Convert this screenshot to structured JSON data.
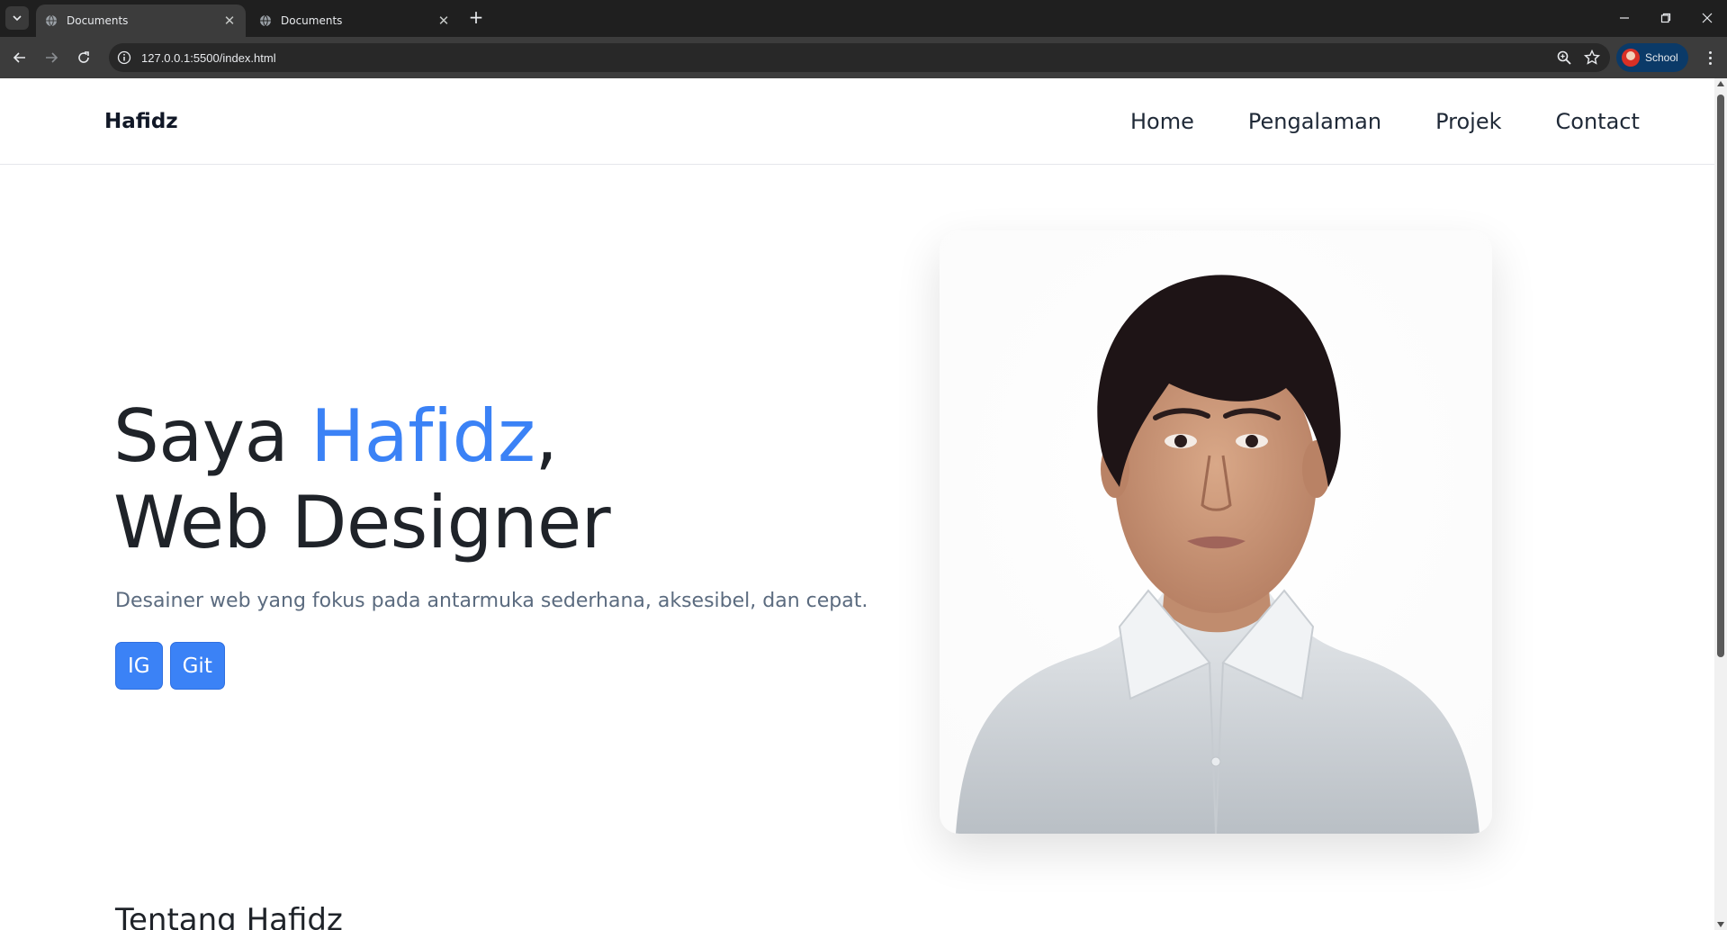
{
  "browser": {
    "tabs": [
      {
        "title": "Documents",
        "active": true
      },
      {
        "title": "Documents",
        "active": false
      }
    ],
    "url": "127.0.0.1:5500/index.html",
    "profile_label": "School",
    "icons": [
      "tab-search-icon",
      "globe-icon",
      "close-icon",
      "plus-icon",
      "minimize-icon",
      "restore-icon",
      "window-close-icon",
      "back-arrow-icon",
      "forward-arrow-icon",
      "reload-icon",
      "site-info-icon",
      "zoom-icon",
      "star-icon",
      "kebab-menu-icon"
    ]
  },
  "site": {
    "brand": "Hafidz",
    "nav": {
      "home": "Home",
      "experience": "Pengalaman",
      "projects": "Projek",
      "contact": "Contact"
    },
    "hero": {
      "title_prefix": "Saya ",
      "title_name": "Hafidz",
      "title_comma": ",",
      "title_line2": "Web Designer",
      "subtitle": "Desainer web yang fokus pada antarmuka sederhana, aksesibel, dan cepat.",
      "buttons": {
        "ig": "IG",
        "git": "Git"
      }
    },
    "about_title": "Tentang Hafidz"
  },
  "colors": {
    "accent": "#3b82f6",
    "chrome_bg": "#1f1f1f",
    "toolbar_bg": "#3c3c3c",
    "profile_bg": "#0b3a68"
  }
}
